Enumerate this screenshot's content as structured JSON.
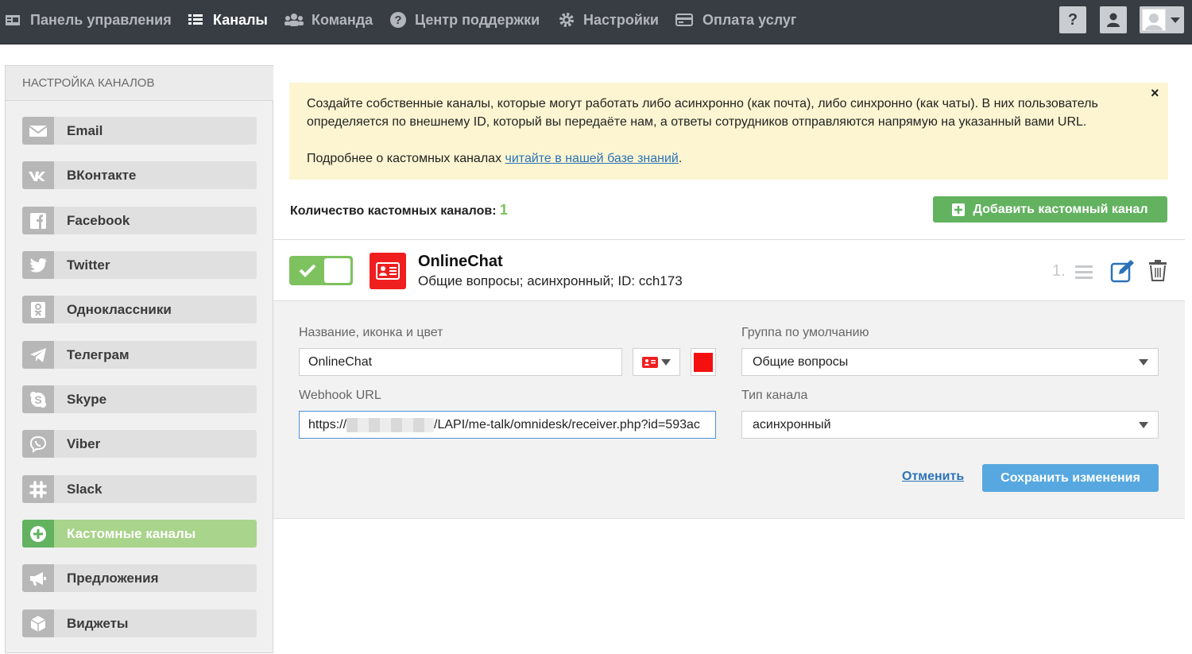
{
  "topnav": {
    "items": [
      {
        "label": "Панель управления",
        "icon": "dashboard-icon"
      },
      {
        "label": "Каналы",
        "icon": "list-icon"
      },
      {
        "label": "Команда",
        "icon": "team-icon"
      },
      {
        "label": "Центр поддержки",
        "icon": "question-circle-icon"
      },
      {
        "label": "Настройки",
        "icon": "gear-icon"
      },
      {
        "label": "Оплата услуг",
        "icon": "credit-card-icon"
      }
    ],
    "active": "Каналы",
    "help_label": "?"
  },
  "sidebar": {
    "title": "НАСТРОЙКА КАНАЛОВ",
    "items": [
      {
        "label": "Email",
        "icon": "envelope-icon"
      },
      {
        "label": "ВКонтакте",
        "icon": "vk-icon"
      },
      {
        "label": "Facebook",
        "icon": "facebook-icon"
      },
      {
        "label": "Twitter",
        "icon": "twitter-icon"
      },
      {
        "label": "Одноклассники",
        "icon": "odnoklassniki-icon"
      },
      {
        "label": "Телеграм",
        "icon": "telegram-icon"
      },
      {
        "label": "Skype",
        "icon": "skype-icon"
      },
      {
        "label": "Viber",
        "icon": "viber-icon"
      },
      {
        "label": "Slack",
        "icon": "slack-icon"
      },
      {
        "label": "Кастомные каналы",
        "icon": "plus-circle-icon"
      },
      {
        "label": "Предложения",
        "icon": "megaphone-icon"
      },
      {
        "label": "Виджеты",
        "icon": "cube-icon"
      }
    ],
    "active": "Кастомные каналы"
  },
  "notice": {
    "line1": "Создайте собственные каналы, которые могут работать либо асинхронно (как почта), либо синхронно (как чаты). В них пользователь",
    "line2": "определяется по внешнему ID, который вы передаёте нам, а ответы сотрудников отправляются напрямую на указанный вами URL.",
    "more_prefix": "Подробнее о кастомных каналах ",
    "more_link": "читайте в нашей базе знаний",
    "more_suffix": ".",
    "close": "×"
  },
  "summary": {
    "count_label": "Количество кастомных каналов:",
    "count_value": "1",
    "add_button": "Добавить кастомный канал"
  },
  "channel": {
    "name": "OnlineChat",
    "description": "Общие вопросы; асинхронный; ID: cch173",
    "order": "1.",
    "enabled": true
  },
  "form": {
    "name_label": "Название, иконка и цвет",
    "name_value": "OnlineChat",
    "color": "#f50f0f",
    "group_label": "Группа по умолчанию",
    "group_value": "Общие вопросы",
    "webhook_label": "Webhook URL",
    "webhook_prefix": "https://",
    "webhook_suffix": "/LAPI/me-talk/omnidesk/receiver.php?id=593ac",
    "type_label": "Тип канала",
    "type_value": "асинхронный",
    "cancel": "Отменить",
    "save": "Сохранить изменения"
  },
  "colors": {
    "topbar": "#383d44",
    "accent_green": "#62b25f",
    "accent_blue": "#57a8e0",
    "brand_red": "#ef1f1f",
    "notice_bg": "#fdf5d1"
  }
}
